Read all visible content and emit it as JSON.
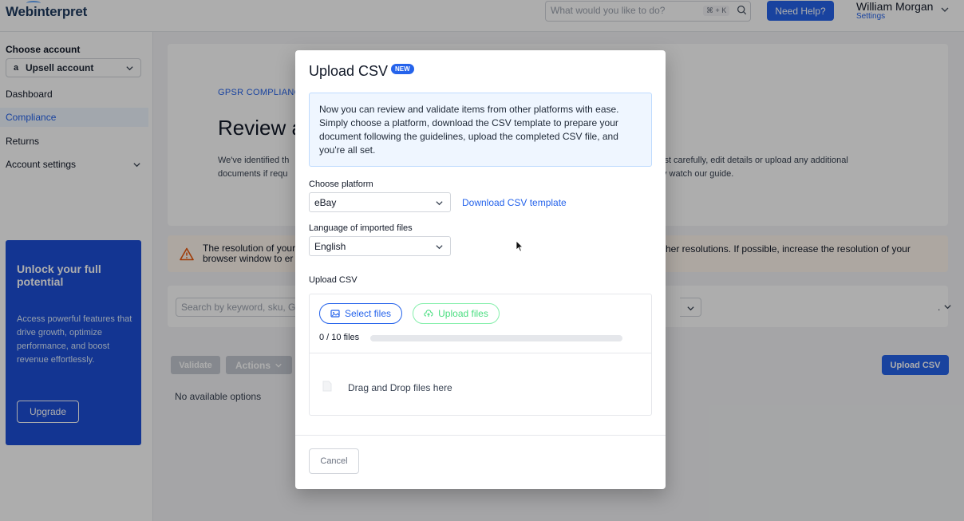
{
  "header": {
    "logo": "Webinterpret",
    "search_placeholder": "What would you like to do?",
    "shortcut": "⌘ + K",
    "need_help": "Need Help?",
    "user_name": "William Morgan",
    "user_settings": "Settings"
  },
  "sidebar": {
    "choose_account": "Choose account",
    "account": "Upsell account",
    "account_icon": "a",
    "nav": {
      "dashboard": "Dashboard",
      "compliance": "Compliance",
      "returns": "Returns",
      "account_settings": "Account settings"
    },
    "promo": {
      "title": "Unlock your full potential",
      "text": "Access powerful features that drive growth, optimize performance, and boost revenue effortlessly.",
      "button": "Upgrade"
    }
  },
  "main": {
    "eyebrow": "GPSR COMPLIANC",
    "title": "Review a",
    "intro_left_1": "We've identified th",
    "intro_left_2": "documents if requ",
    "intro_right_1": "ist carefully, edit details or upload any additional",
    "intro_right_2": "y watch our guide.",
    "warning_left_1": "The resolution of your",
    "warning_left_2": "browser window to er",
    "warning_right": "her resolutions. If possible, increase the resolution of your",
    "search_placeholder": "Search by keyword, sku, G",
    "trailing_text": ".",
    "validate": "Validate",
    "actions": "Actions",
    "upload_csv": "Upload CSV",
    "no_options": "No available options"
  },
  "modal": {
    "title": "Upload CSV",
    "badge": "NEW",
    "info": "Now you can review and validate items from other platforms with ease. Simply choose a platform, download the CSV template to prepare your document following the guidelines, upload the completed CSV file, and you're all set.",
    "platform_label": "Choose platform",
    "platform_value": "eBay",
    "download_template": "Download CSV template",
    "language_label": "Language of imported files",
    "language_value": "English",
    "upload_label": "Upload CSV",
    "select_files": "Select files",
    "upload_files": "Upload files",
    "files_count": "0 / 10 files",
    "progress": 0,
    "drop_text": "Drag and Drop files here",
    "cancel": "Cancel"
  },
  "colors": {
    "accent": "#2563eb",
    "promo_bg": "#1d4ed8",
    "warning": "#ea580c",
    "success_outline": "#86efac"
  },
  "icons": [
    "search-icon",
    "chevron-down-icon",
    "amazon-icon",
    "warning-icon",
    "image-icon",
    "cloud-upload-icon",
    "file-icon",
    "cursor-icon"
  ]
}
